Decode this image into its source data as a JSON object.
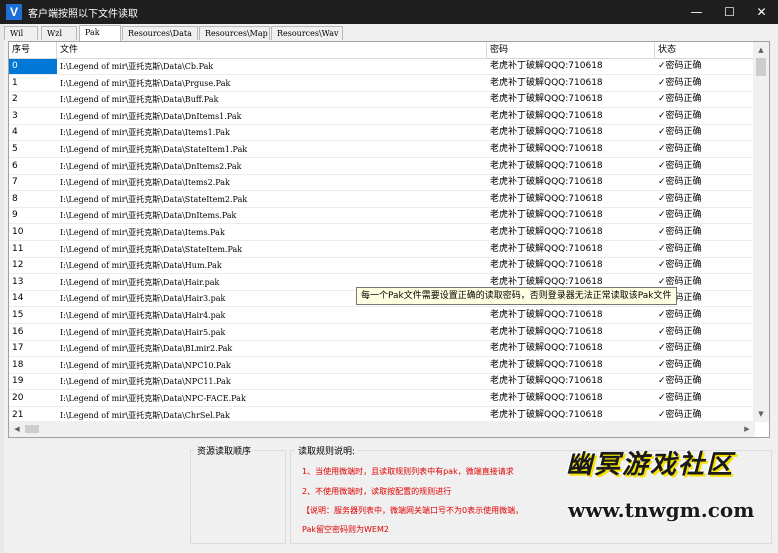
{
  "window": {
    "app_icon": "V",
    "title": "客户端按照以下文件读取",
    "controls": [
      "—",
      "☐",
      "✕"
    ]
  },
  "tabs": [
    {
      "label": "Wil",
      "active": false
    },
    {
      "label": "Wzl",
      "active": false
    },
    {
      "label": "Pak",
      "active": true
    },
    {
      "label": "Resources\\Data",
      "active": false
    },
    {
      "label": "Resources\\Map",
      "active": false
    },
    {
      "label": "Resources\\Wav",
      "active": false
    }
  ],
  "table": {
    "columns": [
      "序号",
      "文件",
      "密码",
      "状态"
    ],
    "rows": [
      {
        "index": "0",
        "file": "I:\\Legend of mir\\亚托克斯\\Data\\Cb.Pak",
        "password": "老虎补丁破解QQQ:710618",
        "status": "✓密码正确"
      },
      {
        "index": "1",
        "file": "I:\\Legend of mir\\亚托克斯\\Data\\Prguse.Pak",
        "password": "老虎补丁破解QQQ:710618",
        "status": "✓密码正确"
      },
      {
        "index": "2",
        "file": "I:\\Legend of mir\\亚托克斯\\Data\\Buff.Pak",
        "password": "老虎补丁破解QQQ:710618",
        "status": "✓密码正确"
      },
      {
        "index": "3",
        "file": "I:\\Legend of mir\\亚托克斯\\Data\\DnItems1.Pak",
        "password": "老虎补丁破解QQQ:710618",
        "status": "✓密码正确"
      },
      {
        "index": "4",
        "file": "I:\\Legend of mir\\亚托克斯\\Data\\Items1.Pak",
        "password": "老虎补丁破解QQQ:710618",
        "status": "✓密码正确"
      },
      {
        "index": "5",
        "file": "I:\\Legend of mir\\亚托克斯\\Data\\StateItem1.Pak",
        "password": "老虎补丁破解QQQ:710618",
        "status": "✓密码正确"
      },
      {
        "index": "6",
        "file": "I:\\Legend of mir\\亚托克斯\\Data\\DnItems2.Pak",
        "password": "老虎补丁破解QQQ:710618",
        "status": "✓密码正确"
      },
      {
        "index": "7",
        "file": "I:\\Legend of mir\\亚托克斯\\Data\\Items2.Pak",
        "password": "老虎补丁破解QQQ:710618",
        "status": "✓密码正确"
      },
      {
        "index": "8",
        "file": "I:\\Legend of mir\\亚托克斯\\Data\\StateItem2.Pak",
        "password": "老虎补丁破解QQQ:710618",
        "status": "✓密码正确"
      },
      {
        "index": "9",
        "file": "I:\\Legend of mir\\亚托克斯\\Data\\DnItems.Pak",
        "password": "老虎补丁破解QQQ:710618",
        "status": "✓密码正确"
      },
      {
        "index": "10",
        "file": "I:\\Legend of mir\\亚托克斯\\Data\\Items.Pak",
        "password": "老虎补丁破解QQQ:710618",
        "status": "✓密码正确"
      },
      {
        "index": "11",
        "file": "I:\\Legend of mir\\亚托克斯\\Data\\StateItem.Pak",
        "password": "老虎补丁破解QQQ:710618",
        "status": "✓密码正确"
      },
      {
        "index": "12",
        "file": "I:\\Legend of mir\\亚托克斯\\Data\\Hum.Pak",
        "password": "老虎补丁破解QQQ:710618",
        "status": "✓密码正确"
      },
      {
        "index": "13",
        "file": "I:\\Legend of mir\\亚托克斯\\Data\\Hair.pak",
        "password": "老虎补丁破解QQQ:710618",
        "status": "✓密码正确"
      },
      {
        "index": "14",
        "file": "I:\\Legend of mir\\亚托克斯\\Data\\Hair3.pak",
        "password": "老虎补丁破解QQQ:710618",
        "status": "✓密码正确"
      },
      {
        "index": "15",
        "file": "I:\\Legend of mir\\亚托克斯\\Data\\Hair4.pak",
        "password": "老虎补丁破解QQQ:710618",
        "status": "✓密码正确"
      },
      {
        "index": "16",
        "file": "I:\\Legend of mir\\亚托克斯\\Data\\Hair5.pak",
        "password": "老虎补丁破解QQQ:710618",
        "status": "✓密码正确"
      },
      {
        "index": "17",
        "file": "I:\\Legend of mir\\亚托克斯\\Data\\BLmir2.Pak",
        "password": "老虎补丁破解QQQ:710618",
        "status": "✓密码正确"
      },
      {
        "index": "18",
        "file": "I:\\Legend of mir\\亚托克斯\\Data\\NPC10.Pak",
        "password": "老虎补丁破解QQQ:710618",
        "status": "✓密码正确"
      },
      {
        "index": "19",
        "file": "I:\\Legend of mir\\亚托克斯\\Data\\NPC11.Pak",
        "password": "老虎补丁破解QQQ:710618",
        "status": "✓密码正确"
      },
      {
        "index": "20",
        "file": "I:\\Legend of mir\\亚托克斯\\Data\\NPC-FACE.Pak",
        "password": "老虎补丁破解QQQ:710618",
        "status": "✓密码正确"
      },
      {
        "index": "21",
        "file": "I:\\Legend of mir\\亚托克斯\\Data\\ChrSel.Pak",
        "password": "老虎补丁破解QQQ:710618",
        "status": "✓密码正确"
      }
    ]
  },
  "tooltip": "每一个Pak文件需要设置正确的读取密码，否则登录器无法正常读取该Pak文件",
  "bottom": {
    "resource_order_title": "资源读取顺序",
    "rules_title": "读取规则说明:",
    "rules": [
      "1、当使用微端时，且读取规则列表中有pak，微端直接请求",
      "2、不使用微端时，读取按配置的规则进行",
      "【说明：服务器列表中，微端网关端口号不为0表示使用微端，",
      "Pak留空密码则为WEM2"
    ]
  },
  "watermark": {
    "title": "幽冥游戏社区",
    "url": "www.tnwgm.com"
  },
  "colors": {
    "titlebar": "#1f1f1f",
    "selection": "#0078d7",
    "rule_text": "#e00000",
    "tooltip_bg": "#ffffe1"
  }
}
